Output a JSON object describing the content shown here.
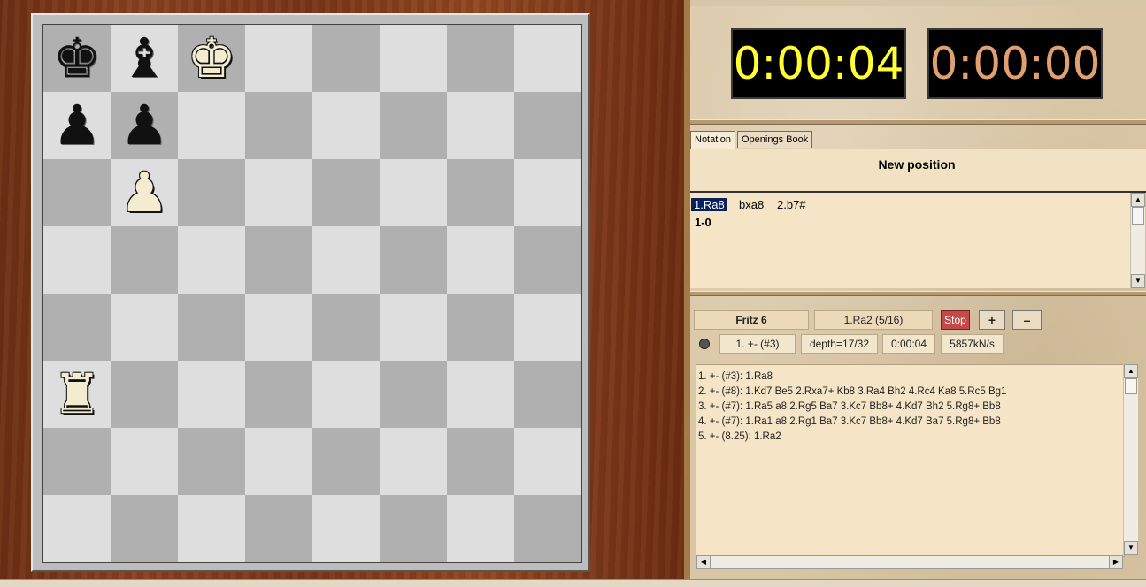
{
  "board": {
    "ranks": [
      [
        {
          "p": "♚",
          "c": "black"
        },
        {
          "p": "♝",
          "c": "black"
        },
        {
          "p": "♚",
          "c": "white"
        },
        null,
        null,
        null,
        null,
        null
      ],
      [
        {
          "p": "♟",
          "c": "black"
        },
        {
          "p": "♟",
          "c": "black"
        },
        null,
        null,
        null,
        null,
        null,
        null
      ],
      [
        null,
        {
          "p": "♟",
          "c": "white"
        },
        null,
        null,
        null,
        null,
        null,
        null
      ],
      [
        null,
        null,
        null,
        null,
        null,
        null,
        null,
        null
      ],
      [
        null,
        null,
        null,
        null,
        null,
        null,
        null,
        null
      ],
      [
        {
          "p": "♜",
          "c": "white"
        },
        null,
        null,
        null,
        null,
        null,
        null,
        null
      ],
      [
        null,
        null,
        null,
        null,
        null,
        null,
        null,
        null
      ],
      [
        null,
        null,
        null,
        null,
        null,
        null,
        null,
        null
      ]
    ]
  },
  "clocks": {
    "white": "0:00:04",
    "black": "0:00:00"
  },
  "tabs": {
    "notation": "Notation",
    "openings": "Openings Book"
  },
  "notation": {
    "title": "New position",
    "move1": "1.Ra8",
    "move2": "bxa8",
    "move3": "2.b7#",
    "result": "1-0"
  },
  "engine": {
    "name": "Fritz 6",
    "current_move": "1.Ra2 (5/16)",
    "stop_label": "Stop",
    "plus_label": "+",
    "minus_label": "–",
    "eval": "1. +- (#3)",
    "depth": "depth=17/32",
    "time": "0:00:04",
    "speed": "5857kN/s"
  },
  "analysis": {
    "lines": [
      "1. +- (#3): 1.Ra8",
      "2. +- (#8): 1.Kd7 Be5 2.Rxa7+ Kb8 3.Ra4 Bh2 4.Rc4 Ka8 5.Rc5 Bg1",
      "3. +- (#7): 1.Ra5 a8 2.Rg5 Ba7 3.Kc7 Bb8+ 4.Kd7 Bh2 5.Rg8+ Bb8",
      "4. +- (#7): 1.Ra1 a8 2.Rg1 Ba7 3.Kc7 Bb8+ 4.Kd7 Ba7 5.Rg8+ Bb8",
      "5. +- (8.25): 1.Ra2"
    ]
  }
}
